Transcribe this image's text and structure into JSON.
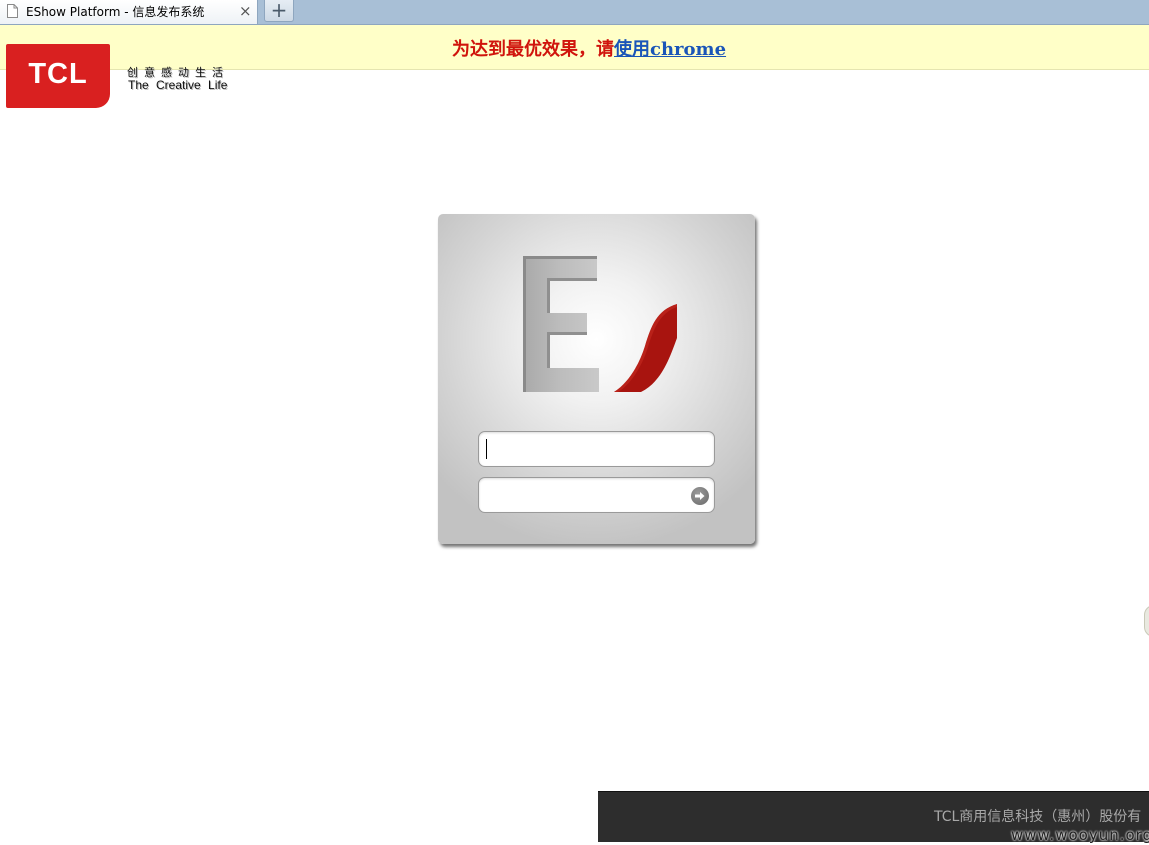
{
  "browser": {
    "tab_title": "EShow Platform - 信息发布系统",
    "close_glyph": "×",
    "new_tab_glyph": "+"
  },
  "notice": {
    "prefix": "为达到最优效果，请",
    "link_text": "使用chrome"
  },
  "brand": {
    "logo_text": "TCL",
    "slogan_cn": "创意感动生活",
    "slogan_en": "The Creative Life",
    "logo_color": "#d92020"
  },
  "login": {
    "username_value": "",
    "password_value": "",
    "submit_icon": "arrow-right-icon",
    "accent_color": "#a8140f"
  },
  "footer": {
    "company": "TCL商用信息科技（惠州）股份有"
  },
  "watermark": "www.wooyun.org"
}
